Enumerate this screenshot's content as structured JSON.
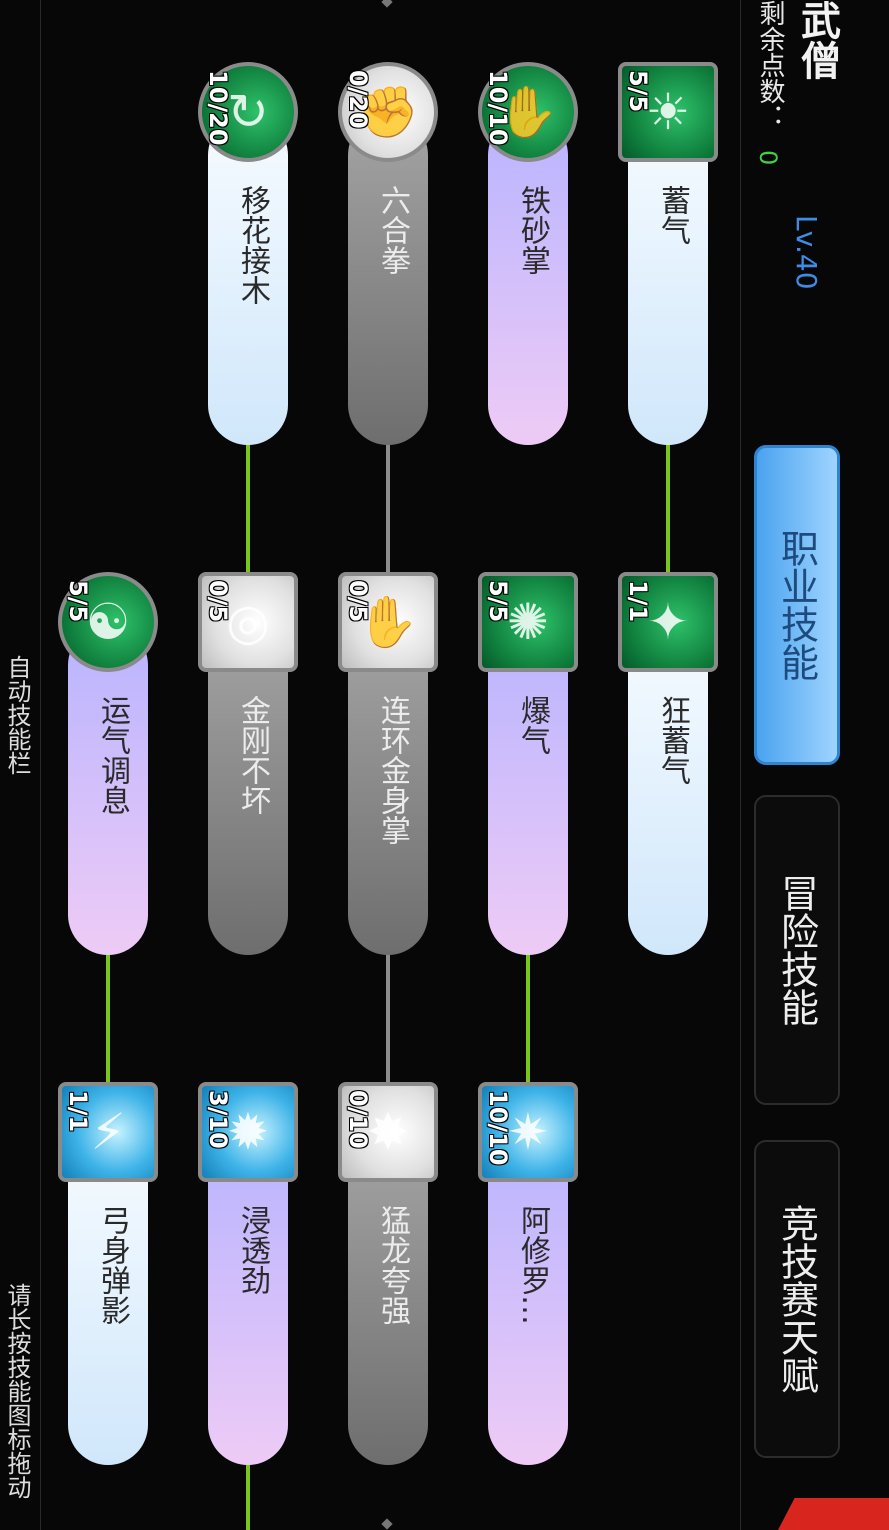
{
  "header": {
    "title": "武僧",
    "points_label": "剩余点数：",
    "points_value": "0",
    "level": "Lv.40"
  },
  "tabs": [
    {
      "label": "职业技能",
      "active": true
    },
    {
      "label": "冒险技能",
      "active": false
    },
    {
      "label": "竞技赛天赋",
      "active": false
    }
  ],
  "skills": [
    {
      "name": "蓄气",
      "level": "5/5",
      "style": "white",
      "icon": "sun-fist-icon"
    },
    {
      "name": "狂蓄气",
      "level": "1/1",
      "style": "white",
      "icon": "sparkle-aura-icon"
    },
    {
      "name": "铁砂掌",
      "level": "10/10",
      "style": "purple",
      "icon": "palm-strike-icon"
    },
    {
      "name": "爆气",
      "level": "5/5",
      "style": "purple",
      "icon": "burst-aura-icon"
    },
    {
      "name": "阿修罗…",
      "level": "10/10",
      "style": "purple",
      "icon": "asura-icon"
    },
    {
      "name": "六合拳",
      "level": "0/20",
      "style": "grey",
      "icon": "fist-combo-icon"
    },
    {
      "name": "连环金身掌",
      "level": "0/5",
      "style": "grey",
      "icon": "golden-palm-icon"
    },
    {
      "name": "猛龙夸强",
      "level": "0/10",
      "style": "grey",
      "icon": "dragon-icon"
    },
    {
      "name": "移花接木",
      "level": "10/20",
      "style": "white",
      "icon": "swirl-counter-icon"
    },
    {
      "name": "金刚不坏",
      "level": "0/5",
      "style": "grey",
      "icon": "diamond-body-icon"
    },
    {
      "name": "浸透劲",
      "level": "3/10",
      "style": "purple",
      "icon": "penetrate-icon"
    },
    {
      "name": "运气调息",
      "level": "5/5",
      "style": "purple",
      "icon": "meditate-icon"
    },
    {
      "name": "弓身弹影",
      "level": "1/1",
      "style": "white",
      "icon": "dash-shadow-icon"
    }
  ],
  "footer": {
    "auto_skill_bar": "自动技能栏",
    "hint": "请长按技能图标拖动"
  },
  "colors": {
    "active_tab": "#4aa3ef",
    "points": "#3fd33f",
    "level": "#3f8be6",
    "connector": "#7bc61e"
  }
}
